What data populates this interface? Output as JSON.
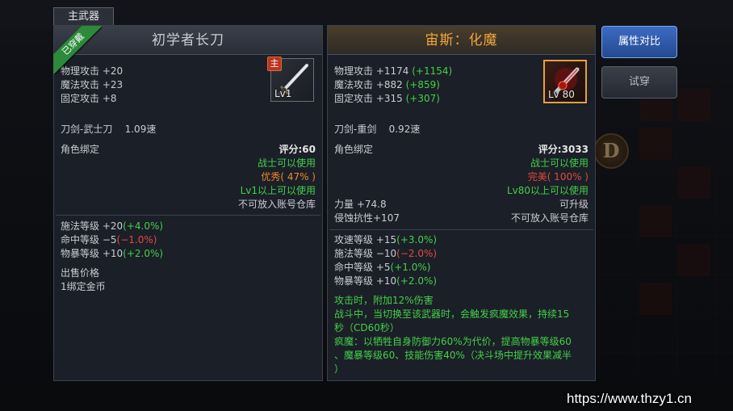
{
  "tab_label": "主武器",
  "left": {
    "equipped_ribbon": "已穿戴",
    "title": "初学者长刀",
    "main_tag": "主",
    "icon_name": "sword-icon",
    "icon_level": "Lv1",
    "stats": [
      "物理攻击 +20",
      "魔法攻击 +23",
      "固定攻击 +8"
    ],
    "weapon_type": "刀剑-武士刀",
    "weapon_speed": "1.09速",
    "bind_label": "角色绑定",
    "score": "评分:60",
    "class_req": "战士可以使用",
    "quality": "优秀( 47% )",
    "level_req": "Lv1以上可以使用",
    "storage_note": "不可放入账号仓库",
    "extra_stats": [
      {
        "name": "施法等级 +20",
        "pct": "(+4.0%)",
        "tone": "green"
      },
      {
        "name": "命中等级 −5",
        "pct": "(−1.0%)",
        "tone": "red"
      },
      {
        "name": "物暴等级 +10",
        "pct": "(+2.0%)",
        "tone": "green"
      }
    ],
    "sell_label": "出售价格",
    "sell_value": "1绑定金币"
  },
  "right": {
    "title": "宙斯：化魔",
    "icon_name": "demon-blade-icon",
    "icon_level": "Lv 80",
    "stats": [
      {
        "label": "物理攻击 +1174",
        "diff": "(+1154)"
      },
      {
        "label": "魔法攻击 +882",
        "diff": "(+859)"
      },
      {
        "label": "固定攻击 +315",
        "diff": "(+307)"
      }
    ],
    "weapon_type": "刀剑-重剑",
    "weapon_speed": "0.92速",
    "bind_label": "角色绑定",
    "score": "评分:3033",
    "class_req": "战士可以使用",
    "quality": "完美( 100% )",
    "level_req": "Lv80以上可以使用",
    "power": "力量 +74.8",
    "upgradable": "可升级",
    "corrosion": "侵蚀抗性+107",
    "storage_note": "不可放入账号仓库",
    "extra_stats": [
      {
        "name": "攻速等级 +15",
        "pct": "(+3.0%)",
        "tone": "green"
      },
      {
        "name": "施法等级 −10",
        "pct": "(−2.0%)",
        "tone": "red"
      },
      {
        "name": "命中等级 +5",
        "pct": "(+1.0%)",
        "tone": "green"
      },
      {
        "name": "物暴等级 +10",
        "pct": "(+2.0%)",
        "tone": "green"
      }
    ],
    "effect_lines": [
      "攻击时，附加12%伤害",
      "战斗中，当切换至该武器时，会触发疯魔效果，持续15",
      "秒（CD60秒）",
      "疯魔：以牺牲自身防御力60%为代价，提高物暴等级60",
      "、魔暴等级60、技能伤害40%（决斗场中提升效果减半",
      "）"
    ]
  },
  "buttons": {
    "compare": "属性对比",
    "try_on": "试穿"
  },
  "bg_badge": "D",
  "watermark": "https://www.thzy1.cn",
  "colors": {
    "green": "#43d04a",
    "red": "#e24a3f",
    "orange": "#f08a2a",
    "gold_title": "#f0a63c",
    "compare_button": "#2f5bb0"
  }
}
